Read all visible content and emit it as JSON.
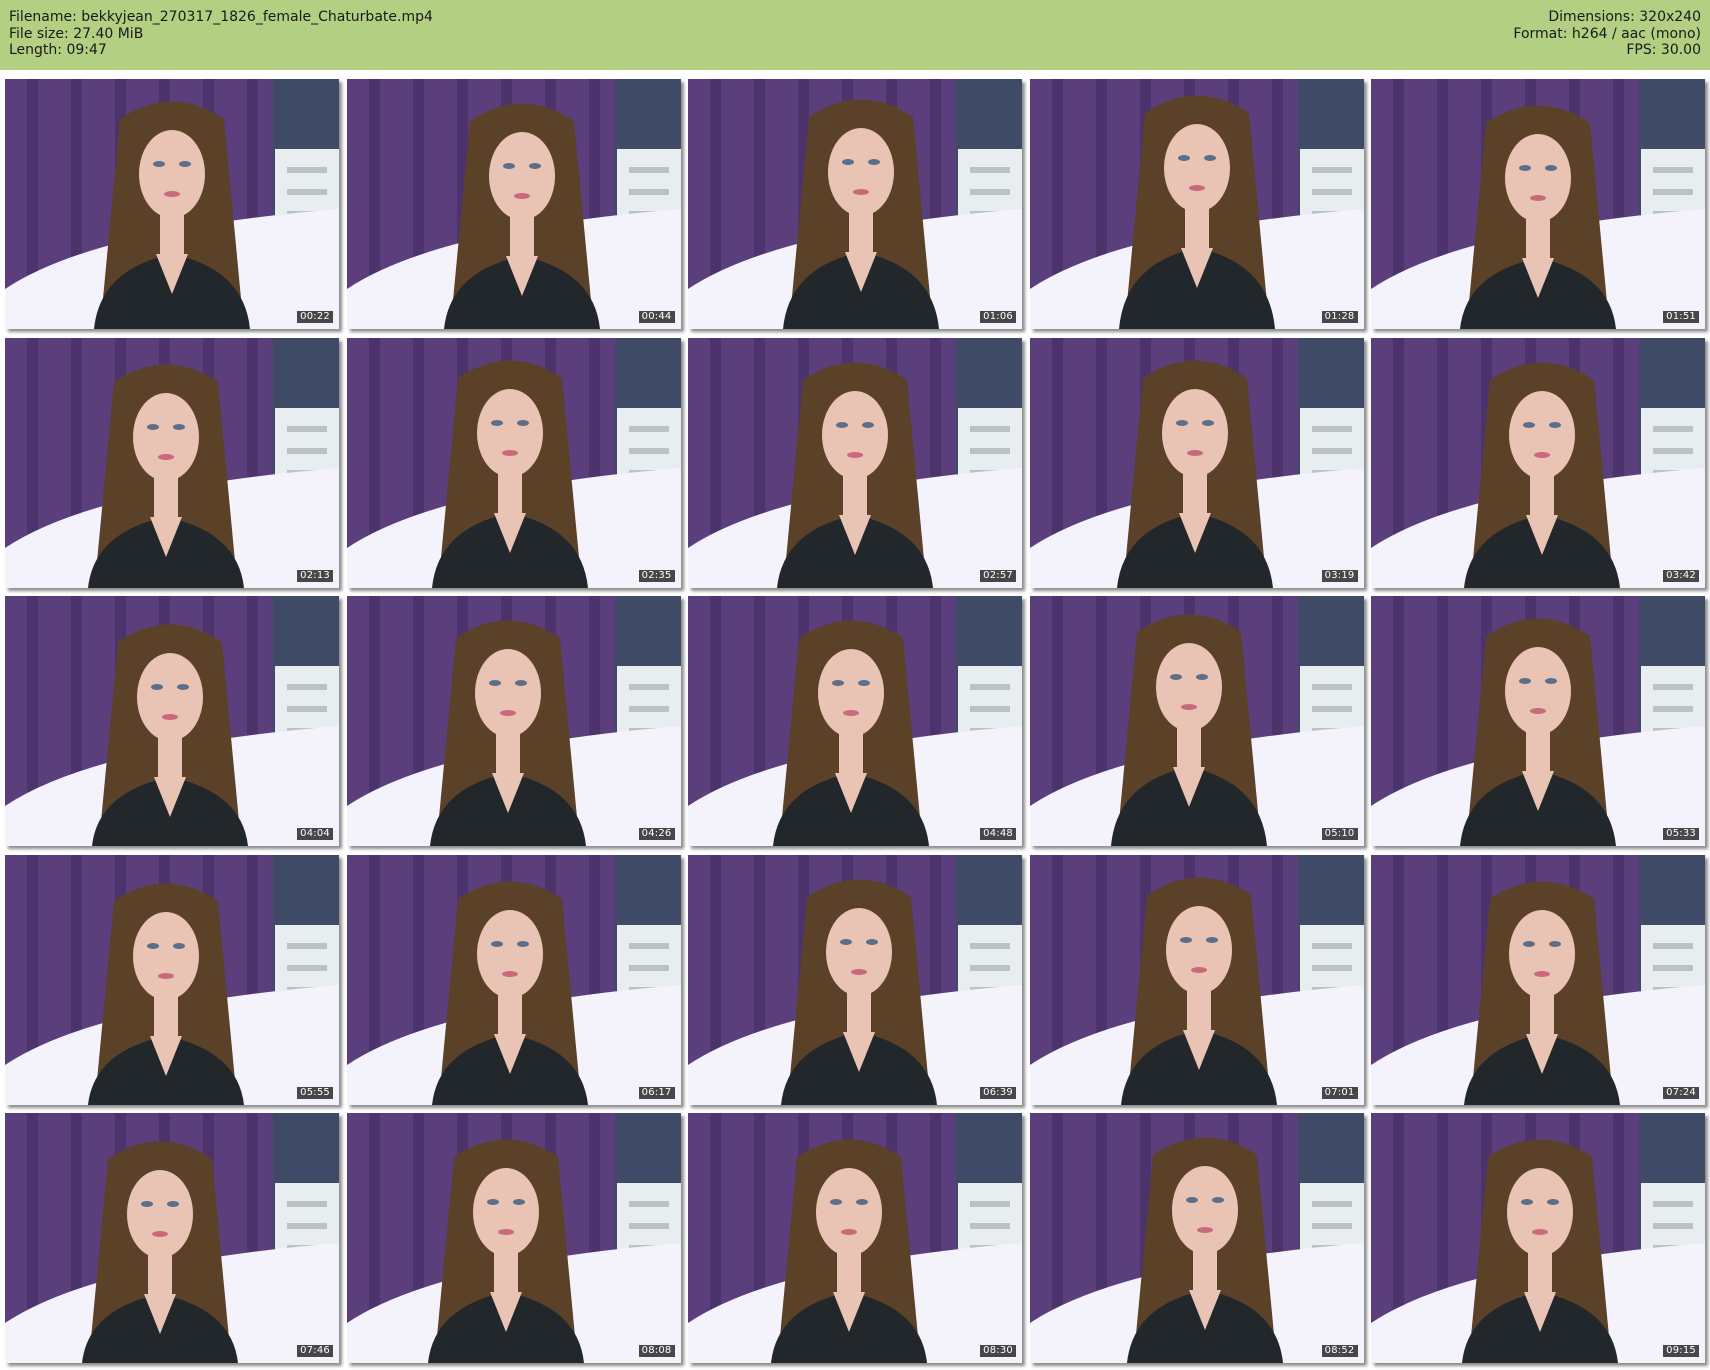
{
  "header": {
    "filename_line": "Filename: bekkyjean_270317_1826_female_Chaturbate.mp4",
    "filesize_line": "File size: 27.40 MiB",
    "length_line": "Length: 09:47",
    "dimensions_line": "Dimensions: 320x240",
    "format_line": "Format: h264 / aac (mono)",
    "fps_line": "FPS: 30.00"
  },
  "thumbnails": [
    {
      "timestamp": "00:22"
    },
    {
      "timestamp": "00:44"
    },
    {
      "timestamp": "01:06"
    },
    {
      "timestamp": "01:28"
    },
    {
      "timestamp": "01:51"
    },
    {
      "timestamp": "02:13"
    },
    {
      "timestamp": "02:35"
    },
    {
      "timestamp": "02:57"
    },
    {
      "timestamp": "03:19"
    },
    {
      "timestamp": "03:42"
    },
    {
      "timestamp": "04:04"
    },
    {
      "timestamp": "04:26"
    },
    {
      "timestamp": "04:48"
    },
    {
      "timestamp": "05:10"
    },
    {
      "timestamp": "05:33"
    },
    {
      "timestamp": "05:55"
    },
    {
      "timestamp": "06:17"
    },
    {
      "timestamp": "06:39"
    },
    {
      "timestamp": "07:01"
    },
    {
      "timestamp": "07:24"
    },
    {
      "timestamp": "07:46"
    },
    {
      "timestamp": "08:08"
    },
    {
      "timestamp": "08:30"
    },
    {
      "timestamp": "08:52"
    },
    {
      "timestamp": "09:15"
    }
  ],
  "colors": {
    "header_bg": "#b2cf82",
    "curtain": "#5b3f7d",
    "curtain_dark": "#3f2a5c",
    "bed": "#f4f2fb",
    "hair": "#5a4128",
    "skin": "#e9c3b3",
    "top": "#22272b",
    "dresser": "#e8eef0"
  }
}
